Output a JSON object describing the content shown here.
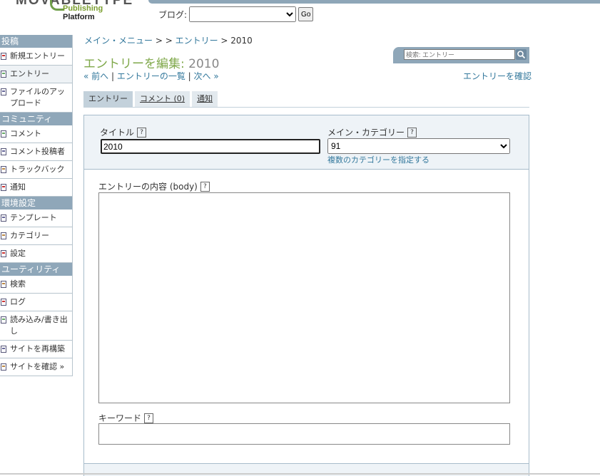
{
  "header": {
    "logo_main": "MOVABLETYPE",
    "logo_sub": "Publishing",
    "logo_sub2": "Platform",
    "blog_label": "ブログ:",
    "blog_value": "",
    "go_label": "Go"
  },
  "sidebar": {
    "sections": [
      {
        "title": "投稿",
        "items": [
          {
            "label": "新規エントリー",
            "icon": "new-entry-icon"
          },
          {
            "label": "エントリー",
            "icon": "entry-icon",
            "active": true
          },
          {
            "label": "ファイルのアップロード",
            "icon": "upload-icon"
          }
        ]
      },
      {
        "title": "コミュニティ",
        "items": [
          {
            "label": "コメント",
            "icon": "comment-icon"
          },
          {
            "label": "コメント投稿者",
            "icon": "commenter-icon"
          },
          {
            "label": "トラックバック",
            "icon": "trackback-icon"
          },
          {
            "label": "通知",
            "icon": "notification-icon"
          }
        ]
      },
      {
        "title": "環境設定",
        "items": [
          {
            "label": "テンプレート",
            "icon": "template-icon"
          },
          {
            "label": "カテゴリー",
            "icon": "category-icon"
          },
          {
            "label": "設定",
            "icon": "settings-icon"
          }
        ]
      },
      {
        "title": "ユーティリティ",
        "items": [
          {
            "label": "検索",
            "icon": "search-icon"
          },
          {
            "label": "ログ",
            "icon": "log-icon"
          },
          {
            "label": "読み込み/書き出し",
            "icon": "import-export-icon"
          },
          {
            "label": "サイトを再構築",
            "icon": "rebuild-icon"
          },
          {
            "label": "サイトを確認 »",
            "icon": "view-site-icon"
          }
        ]
      }
    ]
  },
  "breadcrumb": {
    "part1": "メイン・メニュー",
    "sep1": " > ",
    "part2": " > ",
    "part3": "エントリー",
    "sep3": " > ",
    "current": "2010"
  },
  "page": {
    "title_prefix": "エントリーを編集: ",
    "title_value": "2010"
  },
  "search": {
    "placeholder": "検索: エントリー"
  },
  "nav": {
    "prev": "« 前へ",
    "sep": " | ",
    "list": "エントリーの一覧",
    "next": "次へ »"
  },
  "confirm_link": "エントリーを確認",
  "tabs": [
    {
      "label": "エントリー",
      "active": true
    },
    {
      "label": "コメント (0)"
    },
    {
      "label": "通知"
    }
  ],
  "form": {
    "title_label": "タイトル",
    "title_value": "2010",
    "category_label": "メイン・カテゴリー",
    "category_value": "91",
    "multi_category_link": "複数のカテゴリーを指定する",
    "body_label": "エントリーの内容 (body)",
    "keywords_label": "キーワード",
    "help": "?"
  },
  "colors": {
    "accent": "#7fa84a",
    "nav_bg": "#8fa7b9",
    "link": "#33789c"
  }
}
